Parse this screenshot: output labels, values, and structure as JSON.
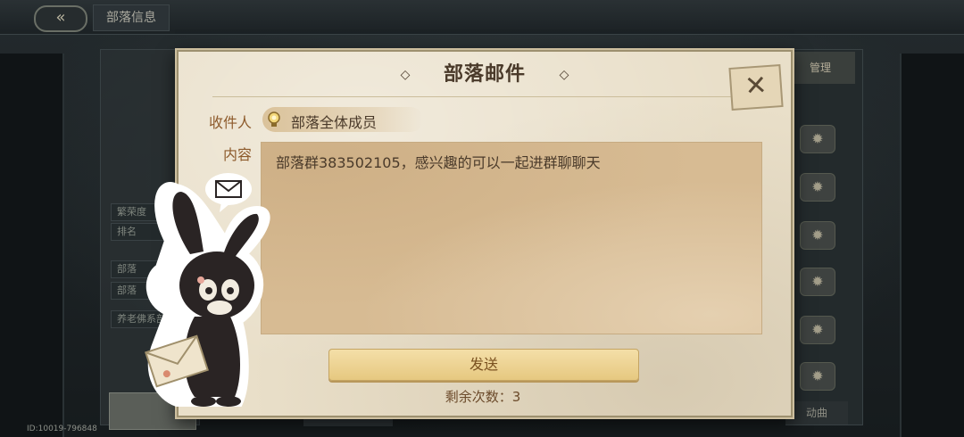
{
  "top_bar": {
    "back_icon": "double-chevron-left-icon",
    "title": "部落信息"
  },
  "background": {
    "manage_tab": "管理",
    "bottom_tab": "动曲",
    "player_id": "ID:10019-796848",
    "left_rows": [
      "繁荣度",
      "排名",
      "部落",
      "部落",
      "养老佛系部"
    ]
  },
  "dialog": {
    "title": "部落邮件",
    "close_icon": "close-x-icon",
    "recipient_label": "收件人",
    "recipient_icon": "lightbulb-icon",
    "recipient_value": "部落全体成员",
    "content_label": "内容",
    "content_text": "部落群383502105，感兴趣的可以一起进群聊聊天",
    "send_label": "发送",
    "remaining_label": "剩余次数：",
    "remaining_count": "3"
  },
  "colors": {
    "dialog_bg": "#e9dfc9",
    "content_bg": "#d7bb93",
    "label_color": "#8d5a2b",
    "button_bg": "#f0d89a",
    "text_dark": "#4a3a2a"
  }
}
